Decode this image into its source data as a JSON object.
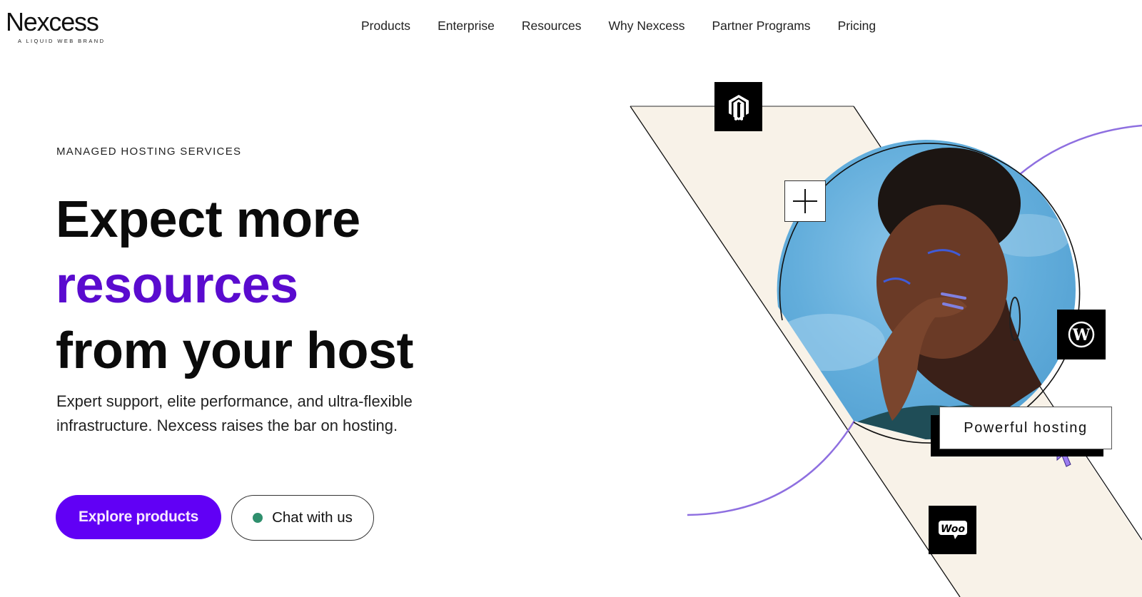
{
  "brand": {
    "name": "Nexcess",
    "tagline": "A LIQUID WEB BRAND"
  },
  "nav": {
    "items": [
      {
        "label": "Products"
      },
      {
        "label": "Enterprise"
      },
      {
        "label": "Resources"
      },
      {
        "label": "Why Nexcess"
      },
      {
        "label": "Partner Programs"
      },
      {
        "label": "Pricing"
      }
    ]
  },
  "hero": {
    "eyebrow": "MANAGED HOSTING SERVICES",
    "headline_line1": "Expect more",
    "headline_accent": "resources",
    "headline_line3": "from your host",
    "subcopy": "Expert support, elite performance, and ultra-flexible infrastructure. Nexcess raises the bar on hosting.",
    "primary_cta": "Explore products",
    "secondary_cta": "Chat with us"
  },
  "illustration": {
    "callout_label": "Powerful hosting",
    "icons": [
      "magento-icon",
      "plus-icon",
      "wordpress-icon",
      "woocommerce-icon",
      "cursor-icon"
    ],
    "woo_label": "Woo",
    "wordpress_letter": "W"
  },
  "colors": {
    "accent_purple": "#6100f5",
    "headline_purple": "#5a0bcf",
    "arc_purple": "#8e6fe0",
    "panel_cream": "#f8f2e8",
    "chat_status_green": "#2f8f6d",
    "sky_blue": "#5faedc"
  }
}
